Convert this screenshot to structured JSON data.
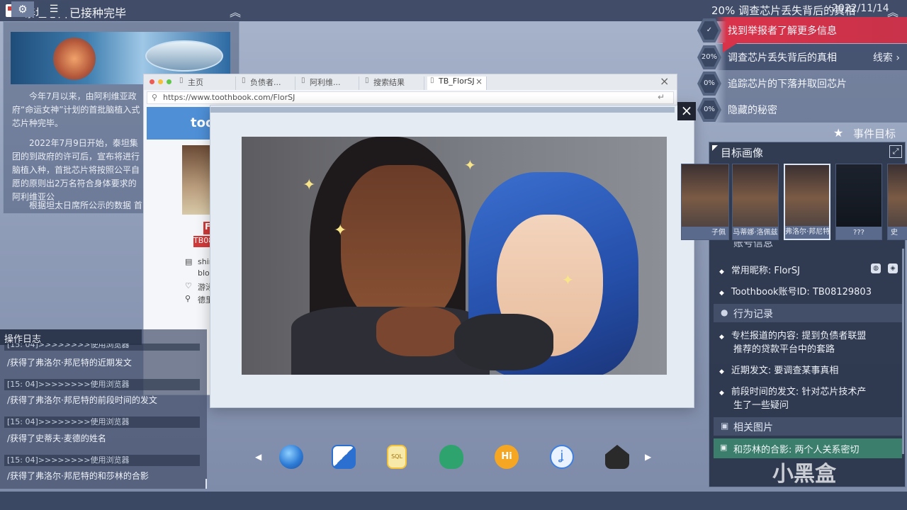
{
  "top": {
    "title": "泰坦芯片已接种完毕",
    "progress_label": "20%  调查芯片丢失背后的真相",
    "collapse_glyph": "︽"
  },
  "article": {
    "p1": "今年7月以来，由阿利维亚政府“命运女神”计划的首批脑植入式芯片种完毕。",
    "p2": "2022年7月9日开始，泰坦集团的到政府的许可后，宣布将进行脑植入种，首批芯片将按照公平自愿的原则出2万名符合身体要求的阿利维亚公",
    "p3": "根据坦太日席所公示的数据  首"
  },
  "browser": {
    "tabs": [
      {
        "label": "主页"
      },
      {
        "label": "负债者..."
      },
      {
        "label": "阿利维..."
      },
      {
        "label": "搜索结果"
      },
      {
        "label": "TB_FlorSJ"
      }
    ],
    "tab_close": "×",
    "close": "×",
    "url": "https://www.toothbook.com/FlorSJ",
    "logo": "toot",
    "profile_name": "F",
    "profile_id": "TB08",
    "rows": [
      {
        "icon": "▤",
        "text": "shin"
      },
      {
        "icon": "",
        "text": "bloc"
      },
      {
        "icon": "♡",
        "text": "游泳"
      },
      {
        "icon": "⚲",
        "text": "德里"
      }
    ]
  },
  "photo_modal": {
    "close": "×"
  },
  "objectives": [
    {
      "badge": "✓",
      "label": "找到举报者了解更多信息",
      "state": "done"
    },
    {
      "badge": "20%",
      "label": "调查芯片丢失背后的真相",
      "state": "active",
      "link": "线索 ›"
    },
    {
      "badge": "0%",
      "label": "追踪芯片的下落并取回芯片",
      "state": "todo"
    },
    {
      "badge": "0%",
      "label": "隐藏的秘密",
      "state": "todo"
    }
  ],
  "event_goal": "事件目标",
  "target": {
    "title": "目标画像",
    "portraits": [
      {
        "name": "子佩"
      },
      {
        "name": "马蒂娜·洛佩兹"
      },
      {
        "name": "弗洛尔·邦尼特"
      },
      {
        "name": "???"
      },
      {
        "name": "史"
      }
    ],
    "account_section_partial": "账号信息",
    "nickname": "常用昵称: FlorSJ",
    "account_id": "Toothbook账号ID: TB08129803",
    "behavior_section": "行为记录",
    "behaviors": [
      "专栏报道的内容: 提到负债者联盟",
      "推荐的贷款平台中的套路",
      "近期发文: 要调查某事真相",
      "前段时间的发文: 针对芯片技术产",
      "生了一些疑问"
    ],
    "related_section": "相关图片",
    "related_item": "和莎林的合影: 两个人关系密切"
  },
  "log": {
    "title": "操作日志",
    "entries": [
      {
        "ts": "[15: 04]>>>>>>>>使用浏览器",
        "msg": "/获得了弗洛尔·邦尼特的近期发文"
      },
      {
        "ts": "[15: 04]>>>>>>>>使用浏览器",
        "msg": "/获得了弗洛尔·邦尼特的前段时间的发文"
      },
      {
        "ts": "[15: 04]>>>>>>>>使用浏览器",
        "msg": "/获得了史蒂夫·麦德的姓名"
      },
      {
        "ts": "[15: 04]>>>>>>>>使用浏览器",
        "msg": "/获得了弗洛尔·邦尼特的和莎林的合影"
      }
    ]
  },
  "dock": {
    "prev": "◀",
    "next": "▶",
    "icons": [
      "globe-icon",
      "mail-icon",
      "sql-file-icon",
      "security-key-icon",
      "hi-chat-icon",
      "fishhook-icon",
      "hacker-hi-icon"
    ],
    "colors": [
      "#2e7cd6",
      "#2b6fd1",
      "#f3c23b",
      "#2ea36e",
      "#f5a623",
      "#3f7fe0",
      "#2a2a2a"
    ]
  },
  "bottom": {
    "settings_glyph": "⚙",
    "list_glyph": "☰",
    "date": "2022/11/14"
  },
  "watermark": "小黑盒"
}
